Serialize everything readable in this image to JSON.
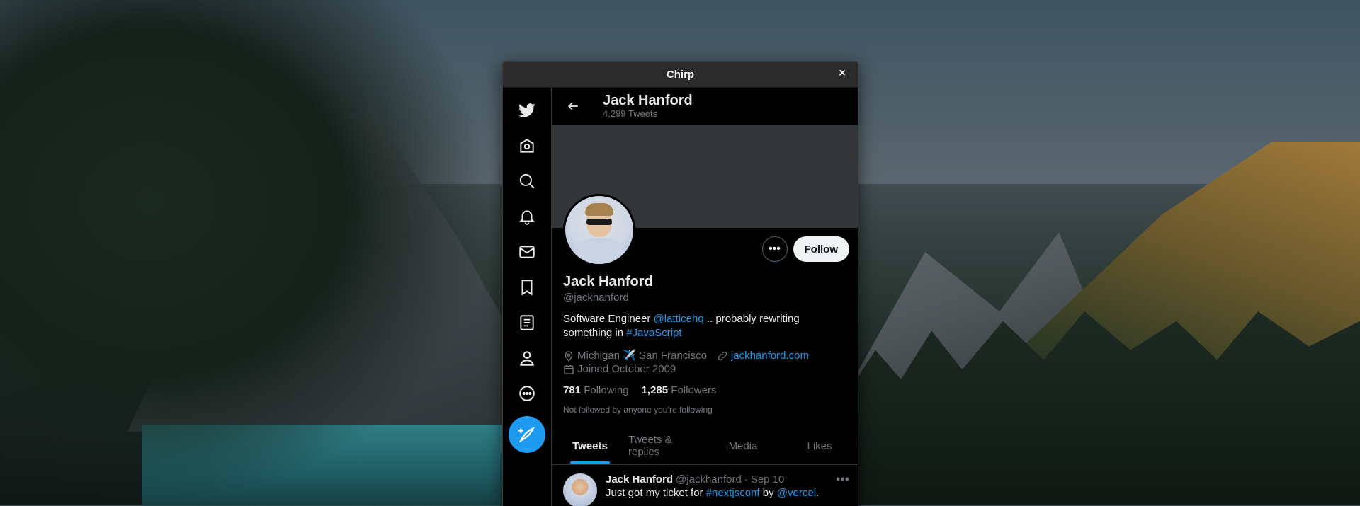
{
  "window": {
    "title": "Chirp",
    "close_glyph": "×"
  },
  "sidebar": {
    "items": [
      {
        "name": "twitter-logo-icon"
      },
      {
        "name": "home-icon"
      },
      {
        "name": "explore-icon"
      },
      {
        "name": "notifications-icon"
      },
      {
        "name": "messages-icon"
      },
      {
        "name": "bookmarks-icon"
      },
      {
        "name": "lists-icon"
      },
      {
        "name": "profile-icon"
      },
      {
        "name": "more-icon"
      }
    ],
    "compose_icon": "compose-icon",
    "accent": "#1d9bf0"
  },
  "header": {
    "name": "Jack Hanford",
    "tweet_count": "4,299 Tweets"
  },
  "profile": {
    "display_name": "Jack Hanford",
    "handle": "@jackhanford",
    "bio_prefix": "Software Engineer ",
    "bio_mention": "@latticehq",
    "bio_middle": " .. probably rewriting something in ",
    "bio_hashtag": "#JavaScript",
    "location": "Michigan ✈️ San Francisco",
    "website": "jackhanford.com",
    "joined": "Joined October 2009",
    "following_count": "781",
    "following_label": "Following",
    "followers_count": "1,285",
    "followers_label": "Followers",
    "not_followed": "Not followed by anyone you’re following",
    "follow_label": "Follow",
    "more_glyph": "•••"
  },
  "tabs": [
    {
      "label": "Tweets",
      "active": true
    },
    {
      "label": "Tweets & replies",
      "active": false
    },
    {
      "label": "Media",
      "active": false
    },
    {
      "label": "Likes",
      "active": false
    }
  ],
  "tweet": {
    "name": "Jack Hanford",
    "handle": "@jackhanford",
    "separator": "·",
    "date": "Sep 10",
    "text_prefix": "Just got my ticket for ",
    "text_hashtag": "#nextjsconf",
    "text_middle": " by ",
    "text_mention": "@vercel",
    "text_suffix": ".",
    "more_glyph": "•••"
  }
}
